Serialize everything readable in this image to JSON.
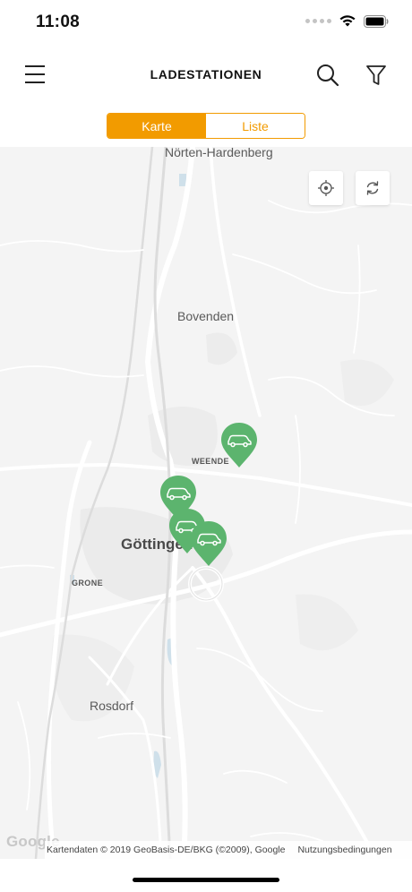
{
  "status_bar": {
    "time": "11:08"
  },
  "header": {
    "title": "LADESTATIONEN"
  },
  "tabs": [
    {
      "label": "Karte",
      "active": true
    },
    {
      "label": "Liste",
      "active": false
    }
  ],
  "map": {
    "labels": {
      "noerten": "Nörten-Hardenberg",
      "bovenden": "Bovenden",
      "weende": "WEENDE",
      "goettingen": "Göttingen",
      "grone": "GRONE",
      "rosdorf": "Rosdorf"
    },
    "google_logo": "Google",
    "attribution": "Kartendaten © 2019 GeoBasis-DE/BKG (©2009), Google",
    "terms": "Nutzungsbedingungen",
    "marker_icon": "car-icon",
    "marker_count": 4
  },
  "colors": {
    "accent": "#f29b00",
    "marker": "#5cb46e",
    "map_background": "#f4f4f4"
  }
}
